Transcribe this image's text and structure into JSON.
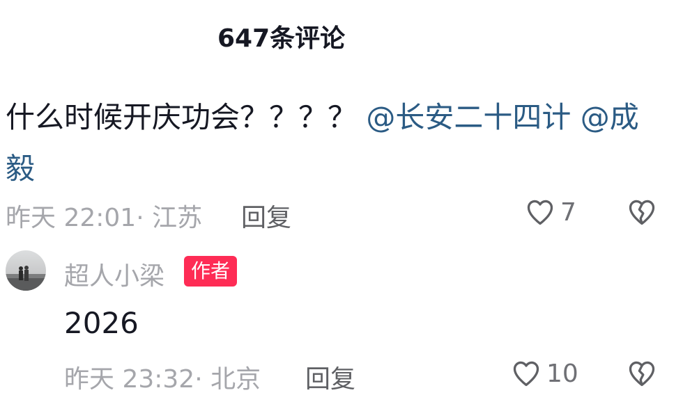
{
  "header": {
    "title": "647条评论"
  },
  "comment": {
    "text": "什么时候开庆功会？？？？ ",
    "mentions": [
      "@长安二十四计",
      "@成毅"
    ],
    "time_location": "昨天 22:01· 江苏",
    "reply_label": "回复",
    "like_count": "7"
  },
  "reply": {
    "username": "超人小梁",
    "badge": "作者",
    "text": "2026",
    "time_location": "昨天 23:32· 北京",
    "reply_label": "回复",
    "like_count": "10"
  },
  "colors": {
    "mention": "#2b5b84",
    "badge": "#fe2c55",
    "meta": "#a5a6ab"
  }
}
